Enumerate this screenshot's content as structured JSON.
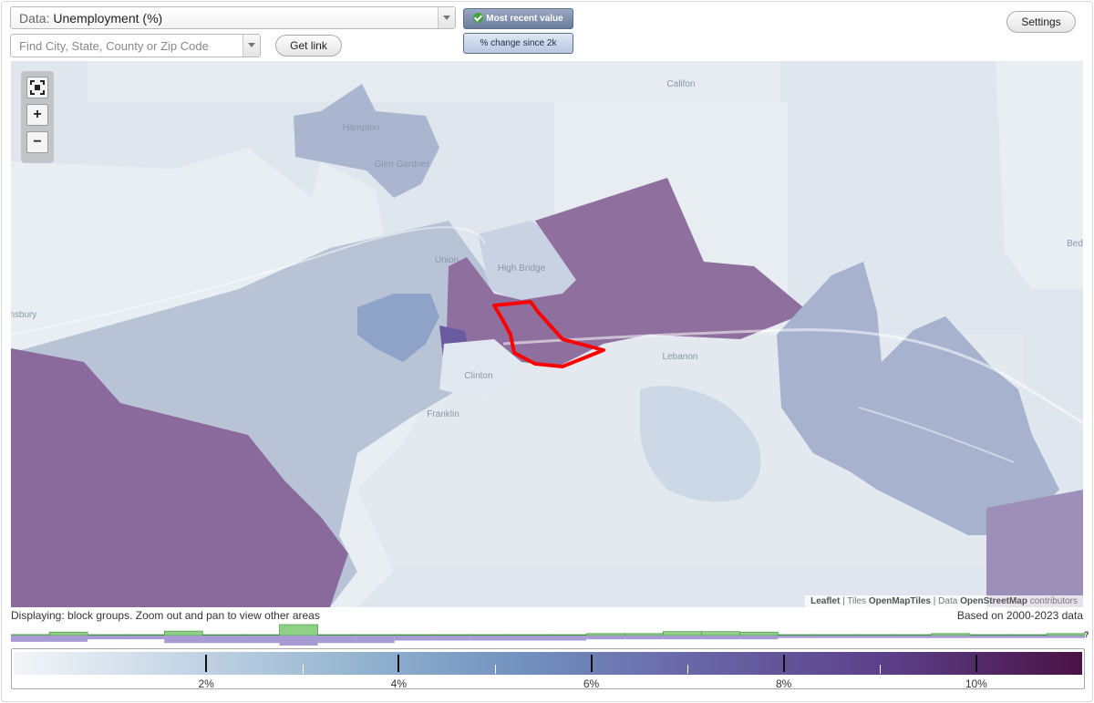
{
  "controls": {
    "data_prefix": "Data:",
    "data_value": "Unemployment (%)",
    "search_placeholder": "Find City, State, County or Zip Code",
    "get_link": "Get link",
    "settings": "Settings",
    "toggle_recent": "Most recent value",
    "toggle_change": "% change since 2k"
  },
  "map": {
    "places": {
      "califon": "Califon",
      "hampton": "Hampton",
      "glen_gardner": "Glen Gardner",
      "union": "Union",
      "high_bridge": "High Bridge",
      "msbury": "msbury",
      "clinton": "Clinton",
      "franklin": "Franklin",
      "lebanon": "Lebanon",
      "bed": "Bed"
    },
    "zoom": {
      "in": "+",
      "out": "−"
    },
    "attribution": {
      "leaflet": "Leaflet",
      "sep1": " | Tiles ",
      "tiles": "OpenMapTiles",
      "sep2": " | Data ",
      "osm": "OpenStreetMap",
      "contributors": " contributors"
    },
    "colors": {
      "low": "#eef2f6",
      "light_blue": "#cdd7e4",
      "mid_blue": "#a7b3cf",
      "purple": "#7d5f94",
      "highlight": "#ff0000"
    }
  },
  "footer": {
    "displaying": "Displaying: block groups. Zoom out and pan to view other areas",
    "based_on": "Based on 2000-2023 data",
    "unknown_marker": "?"
  },
  "legend": {
    "min": 0,
    "max": 11.1,
    "ticks": [
      {
        "value": 2,
        "label": "2%"
      },
      {
        "value": 4,
        "label": "4%"
      },
      {
        "value": 6,
        "label": "6%"
      },
      {
        "value": 8,
        "label": "8%"
      },
      {
        "value": 10,
        "label": "10%"
      }
    ],
    "minor_ticks": [
      3,
      5,
      7,
      9
    ],
    "histogram": {
      "bins": 28,
      "upper": [
        2,
        7,
        0,
        0,
        9,
        0,
        0,
        22,
        0,
        0,
        0,
        0,
        0,
        0,
        0,
        4,
        4,
        8,
        8,
        7,
        0,
        0,
        0,
        0,
        4,
        0,
        0,
        4
      ],
      "lower": [
        5,
        5,
        3,
        3,
        6,
        6,
        6,
        8,
        6,
        6,
        4,
        4,
        4,
        4,
        4,
        3,
        3,
        3,
        3,
        3,
        2,
        2,
        2,
        2,
        2,
        2,
        2,
        2
      ]
    }
  }
}
